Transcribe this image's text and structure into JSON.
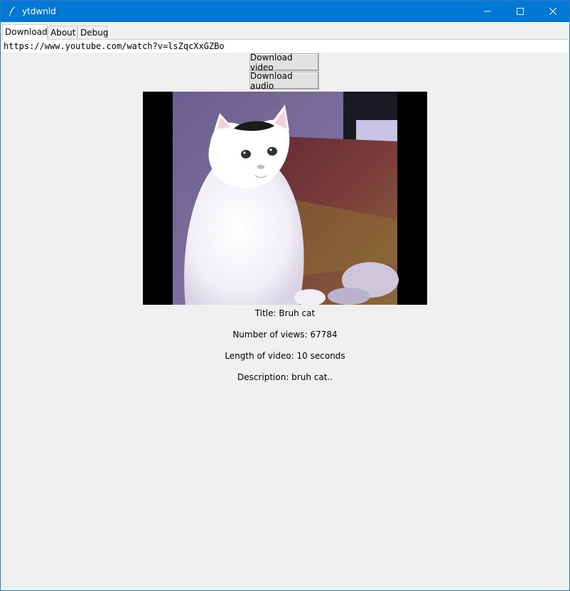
{
  "window": {
    "title": "ytdwnld"
  },
  "tabs": [
    {
      "label": "Download"
    },
    {
      "label": "About"
    },
    {
      "label": "Debug"
    }
  ],
  "url_input": {
    "value": "https://www.youtube.com/watch?v=lsZqcXxGZBo"
  },
  "buttons": {
    "download_video": "Download video",
    "download_audio": "Download audio"
  },
  "video_info": {
    "title": "Title: Bruh cat",
    "views": "Number of views: 67784",
    "length": "Length of video: 10 seconds",
    "description": "Description: bruh cat.."
  },
  "colors": {
    "titlebar": "#0078d4",
    "window_bg": "#f0f0f0"
  }
}
